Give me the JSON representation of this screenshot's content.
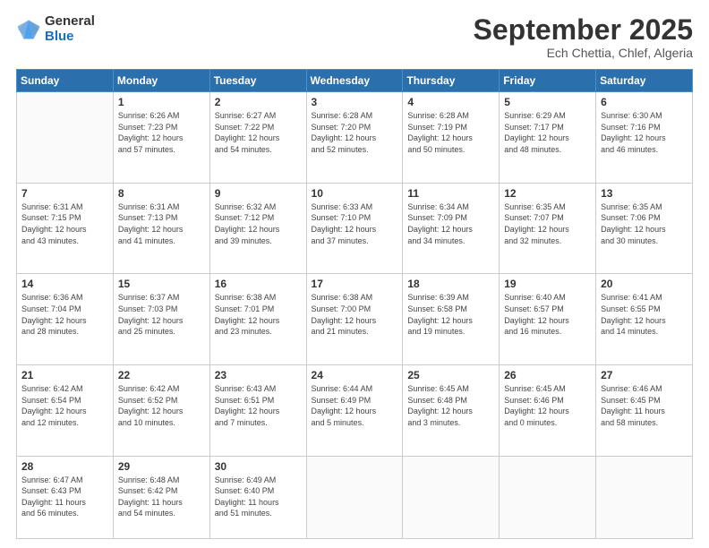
{
  "logo": {
    "general": "General",
    "blue": "Blue"
  },
  "title": "September 2025",
  "subtitle": "Ech Chettia, Chlef, Algeria",
  "days_header": [
    "Sunday",
    "Monday",
    "Tuesday",
    "Wednesday",
    "Thursday",
    "Friday",
    "Saturday"
  ],
  "weeks": [
    [
      {
        "day": "",
        "info": ""
      },
      {
        "day": "1",
        "info": "Sunrise: 6:26 AM\nSunset: 7:23 PM\nDaylight: 12 hours\nand 57 minutes."
      },
      {
        "day": "2",
        "info": "Sunrise: 6:27 AM\nSunset: 7:22 PM\nDaylight: 12 hours\nand 54 minutes."
      },
      {
        "day": "3",
        "info": "Sunrise: 6:28 AM\nSunset: 7:20 PM\nDaylight: 12 hours\nand 52 minutes."
      },
      {
        "day": "4",
        "info": "Sunrise: 6:28 AM\nSunset: 7:19 PM\nDaylight: 12 hours\nand 50 minutes."
      },
      {
        "day": "5",
        "info": "Sunrise: 6:29 AM\nSunset: 7:17 PM\nDaylight: 12 hours\nand 48 minutes."
      },
      {
        "day": "6",
        "info": "Sunrise: 6:30 AM\nSunset: 7:16 PM\nDaylight: 12 hours\nand 46 minutes."
      }
    ],
    [
      {
        "day": "7",
        "info": "Sunrise: 6:31 AM\nSunset: 7:15 PM\nDaylight: 12 hours\nand 43 minutes."
      },
      {
        "day": "8",
        "info": "Sunrise: 6:31 AM\nSunset: 7:13 PM\nDaylight: 12 hours\nand 41 minutes."
      },
      {
        "day": "9",
        "info": "Sunrise: 6:32 AM\nSunset: 7:12 PM\nDaylight: 12 hours\nand 39 minutes."
      },
      {
        "day": "10",
        "info": "Sunrise: 6:33 AM\nSunset: 7:10 PM\nDaylight: 12 hours\nand 37 minutes."
      },
      {
        "day": "11",
        "info": "Sunrise: 6:34 AM\nSunset: 7:09 PM\nDaylight: 12 hours\nand 34 minutes."
      },
      {
        "day": "12",
        "info": "Sunrise: 6:35 AM\nSunset: 7:07 PM\nDaylight: 12 hours\nand 32 minutes."
      },
      {
        "day": "13",
        "info": "Sunrise: 6:35 AM\nSunset: 7:06 PM\nDaylight: 12 hours\nand 30 minutes."
      }
    ],
    [
      {
        "day": "14",
        "info": "Sunrise: 6:36 AM\nSunset: 7:04 PM\nDaylight: 12 hours\nand 28 minutes."
      },
      {
        "day": "15",
        "info": "Sunrise: 6:37 AM\nSunset: 7:03 PM\nDaylight: 12 hours\nand 25 minutes."
      },
      {
        "day": "16",
        "info": "Sunrise: 6:38 AM\nSunset: 7:01 PM\nDaylight: 12 hours\nand 23 minutes."
      },
      {
        "day": "17",
        "info": "Sunrise: 6:38 AM\nSunset: 7:00 PM\nDaylight: 12 hours\nand 21 minutes."
      },
      {
        "day": "18",
        "info": "Sunrise: 6:39 AM\nSunset: 6:58 PM\nDaylight: 12 hours\nand 19 minutes."
      },
      {
        "day": "19",
        "info": "Sunrise: 6:40 AM\nSunset: 6:57 PM\nDaylight: 12 hours\nand 16 minutes."
      },
      {
        "day": "20",
        "info": "Sunrise: 6:41 AM\nSunset: 6:55 PM\nDaylight: 12 hours\nand 14 minutes."
      }
    ],
    [
      {
        "day": "21",
        "info": "Sunrise: 6:42 AM\nSunset: 6:54 PM\nDaylight: 12 hours\nand 12 minutes."
      },
      {
        "day": "22",
        "info": "Sunrise: 6:42 AM\nSunset: 6:52 PM\nDaylight: 12 hours\nand 10 minutes."
      },
      {
        "day": "23",
        "info": "Sunrise: 6:43 AM\nSunset: 6:51 PM\nDaylight: 12 hours\nand 7 minutes."
      },
      {
        "day": "24",
        "info": "Sunrise: 6:44 AM\nSunset: 6:49 PM\nDaylight: 12 hours\nand 5 minutes."
      },
      {
        "day": "25",
        "info": "Sunrise: 6:45 AM\nSunset: 6:48 PM\nDaylight: 12 hours\nand 3 minutes."
      },
      {
        "day": "26",
        "info": "Sunrise: 6:45 AM\nSunset: 6:46 PM\nDaylight: 12 hours\nand 0 minutes."
      },
      {
        "day": "27",
        "info": "Sunrise: 6:46 AM\nSunset: 6:45 PM\nDaylight: 11 hours\nand 58 minutes."
      }
    ],
    [
      {
        "day": "28",
        "info": "Sunrise: 6:47 AM\nSunset: 6:43 PM\nDaylight: 11 hours\nand 56 minutes."
      },
      {
        "day": "29",
        "info": "Sunrise: 6:48 AM\nSunset: 6:42 PM\nDaylight: 11 hours\nand 54 minutes."
      },
      {
        "day": "30",
        "info": "Sunrise: 6:49 AM\nSunset: 6:40 PM\nDaylight: 11 hours\nand 51 minutes."
      },
      {
        "day": "",
        "info": ""
      },
      {
        "day": "",
        "info": ""
      },
      {
        "day": "",
        "info": ""
      },
      {
        "day": "",
        "info": ""
      }
    ]
  ]
}
